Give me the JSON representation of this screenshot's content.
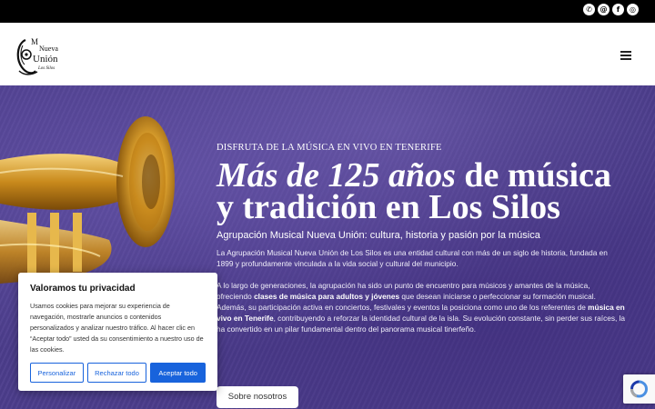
{
  "topbar": {
    "social": [
      {
        "icon": "phone-icon",
        "glyph": "✆"
      },
      {
        "icon": "email-icon",
        "glyph": "@"
      },
      {
        "icon": "facebook-icon",
        "glyph": "f"
      },
      {
        "icon": "instagram-icon",
        "glyph": "◎"
      }
    ]
  },
  "header": {
    "logo": {
      "line1": "M",
      "line2": "Nueva",
      "line3": "Unión",
      "line4": "Los Silos"
    },
    "menu_icon": "hamburger-menu-icon"
  },
  "hero": {
    "kicker": "DISFRUTA DE LA MÚSICA EN VIVO EN TENERIFE",
    "title_em": "Más de 125 años",
    "title_rest": " de música y tradición en Los Silos",
    "subtitle": "Agrupación Musical Nueva Unión: cultura, historia y pasión por la música",
    "para1": "La Agrupación Musical Nueva Unión de Los Silos es una entidad cultural con más de un siglo de historia, fundada en 1899 y profundamente vinculada a la vida social y cultural del municipio.",
    "para2_a": "A lo largo de generaciones, la agrupación ha sido un punto de encuentro para músicos y amantes de la música, ofreciendo ",
    "para2_b": "clases de música para adultos y jóvenes",
    "para2_c": " que desean iniciarse o perfeccionar su formación musical. Además, su participación activa en conciertos, festivales y eventos la posiciona como uno de los referentes de ",
    "para2_d": "música en vivo en Tenerife",
    "para2_e": ", contribuyendo a reforzar la identidad cultural de la isla. Su evolución constante, sin perder sus raíces, la ha convertido en un pilar fundamental dentro del panorama musical tinerfeño.",
    "button": "Sobre nosotros"
  },
  "cookie": {
    "title": "Valoramos tu privacidad",
    "text": "Usamos cookies para mejorar su experiencia de navegación, mostrarle anuncios o contenidos personalizados y analizar nuestro tráfico. Al hacer clic en “Aceptar todo” usted da su consentimiento a nuestro uso de las cookies.",
    "btn_customize": "Personalizar",
    "btn_reject": "Rechazar todo",
    "btn_accept": "Aceptar todo"
  },
  "colors": {
    "accent": "#1863dc",
    "hero_bg": "#4c3d8c",
    "topbar": "#000000"
  }
}
